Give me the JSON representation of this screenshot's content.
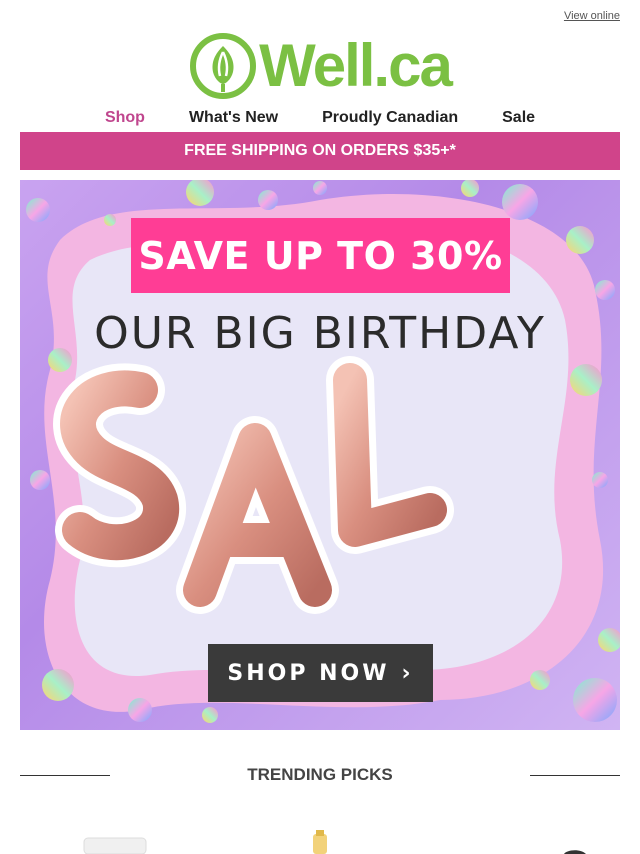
{
  "header": {
    "view_online": "View online",
    "logo_text": "Well.ca",
    "brand_color": "#7bc043"
  },
  "nav": {
    "items": [
      {
        "label": "Shop",
        "active": true
      },
      {
        "label": "What's New"
      },
      {
        "label": "Proudly Canadian"
      },
      {
        "label": "Sale"
      }
    ]
  },
  "shipping_banner": {
    "text": "FREE SHIPPING ON ORDERS $35+*",
    "color": "#d0448a"
  },
  "hero": {
    "save_text": "SAVE UP TO 30%",
    "headline": "OUR BIG BIRTHDAY",
    "balloon_letters": "SAL",
    "cta_label": "SHOP NOW",
    "accent_pink": "#ff3d95"
  },
  "trending": {
    "title": "TRENDING PICKS"
  }
}
